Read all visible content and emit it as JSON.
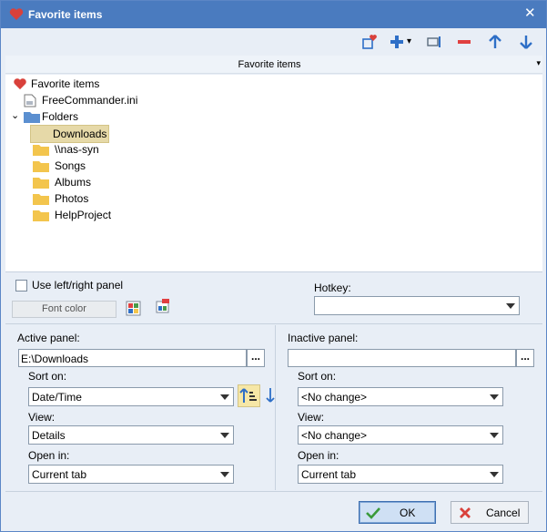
{
  "window": {
    "title": "Favorite items",
    "close": "✕"
  },
  "toolbar": {
    "icons": [
      "new-favorite-icon",
      "add-icon",
      "edit-item-icon",
      "remove-icon",
      "move-up-icon",
      "move-down-icon"
    ],
    "add_dropdown": "▾"
  },
  "column_header": {
    "label": "Favorite items",
    "menu_arrow": "▾"
  },
  "tree": {
    "root": "Favorite items",
    "items": [
      {
        "label": "FreeCommander.ini",
        "icon": "ini-file-icon"
      },
      {
        "label": "Folders",
        "icon": "folder-icon",
        "expanded": true
      }
    ],
    "folders": [
      {
        "label": "Downloads",
        "selected": true
      },
      {
        "label": "\\\\nas-syn"
      },
      {
        "label": "Songs"
      },
      {
        "label": "Albums"
      },
      {
        "label": "Photos"
      },
      {
        "label": "HelpProject"
      }
    ]
  },
  "options": {
    "use_panel_label": "Use left/right panel",
    "use_panel_checked": false,
    "font_color_label": "Font color",
    "hotkey_label": "Hotkey:",
    "hotkey_value": ""
  },
  "active": {
    "title": "Active panel:",
    "path": "E:\\Downloads",
    "browse": "...",
    "sort_label": "Sort on:",
    "sort_value": "Date/Time",
    "view_label": "View:",
    "view_value": "Details",
    "open_label": "Open in:",
    "open_value": "Current tab"
  },
  "inactive": {
    "title": "Inactive panel:",
    "path": "",
    "browse": "...",
    "sort_label": "Sort on:",
    "sort_value": "<No change>",
    "view_label": "View:",
    "view_value": "<No change>",
    "open_label": "Open in:",
    "open_value": "Current tab"
  },
  "buttons": {
    "ok": "OK",
    "cancel": "Cancel"
  },
  "colors": {
    "titlebar": "#4a7bbf",
    "heart": "#d9413b",
    "toolbar_blue": "#2e6fc7",
    "remove_red": "#e04040",
    "folder": "#f3c54d"
  }
}
